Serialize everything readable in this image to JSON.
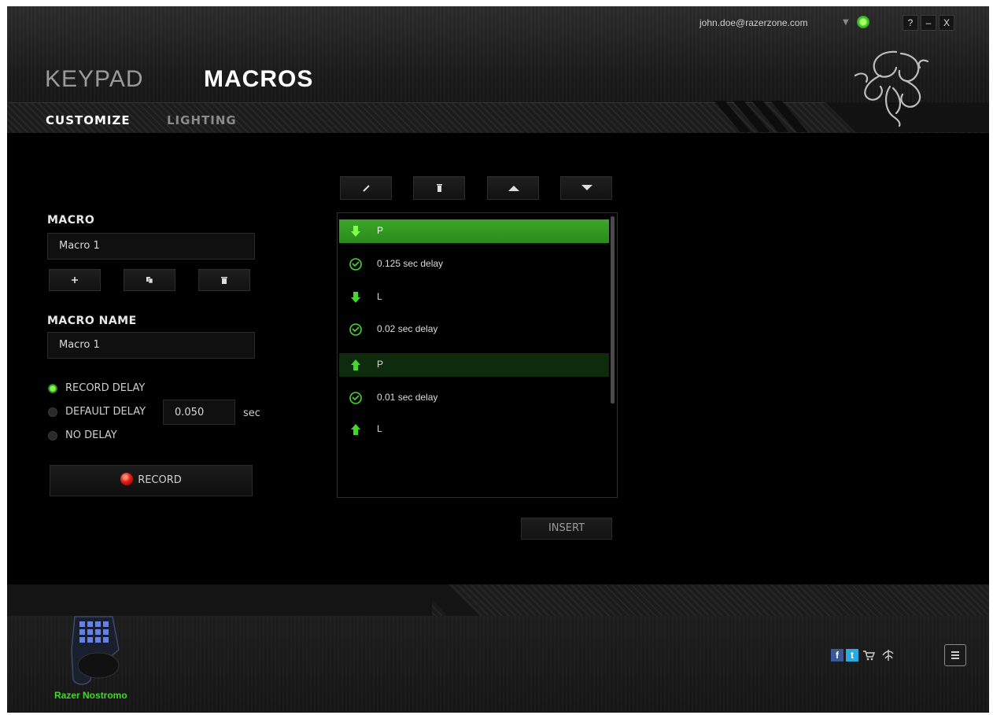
{
  "window": {
    "user_email": "john.doe@razerzone.com",
    "help_label": "?",
    "minimize_label": "–",
    "close_label": "X"
  },
  "nav": {
    "main_tabs": [
      {
        "label": "KEYPAD",
        "active": false
      },
      {
        "label": "MACROS",
        "active": true
      }
    ],
    "sub_tabs": [
      {
        "label": "CUSTOMIZE",
        "active": true
      },
      {
        "label": "LIGHTING",
        "active": false
      }
    ]
  },
  "macro_panel": {
    "macro_label": "MACRO",
    "macro_selected": "Macro 1",
    "macro_name_label": "MACRO NAME",
    "macro_name_value": "Macro 1",
    "delay_options": [
      {
        "label": "RECORD DELAY",
        "selected": true
      },
      {
        "label": "DEFAULT DELAY",
        "selected": false
      },
      {
        "label": "NO DELAY",
        "selected": false
      }
    ],
    "default_delay_value": "0.050",
    "delay_unit": "sec",
    "record_label": "RECORD"
  },
  "macro_list": {
    "items": [
      {
        "type": "key-down",
        "text": "P",
        "icon": "arrow-down-icon",
        "state": "selected"
      },
      {
        "type": "delay",
        "text": "0.125 sec delay",
        "icon": "clock-icon",
        "state": "normal"
      },
      {
        "type": "key-down",
        "text": "L",
        "icon": "arrow-down-icon",
        "state": "normal"
      },
      {
        "type": "delay",
        "text": "0.02 sec delay",
        "icon": "clock-icon",
        "state": "normal"
      },
      {
        "type": "key-up",
        "text": "P",
        "icon": "arrow-up-icon",
        "state": "hover"
      },
      {
        "type": "delay",
        "text": "0.01 sec delay",
        "icon": "clock-icon",
        "state": "normal"
      },
      {
        "type": "key-up",
        "text": "L",
        "icon": "arrow-up-icon",
        "state": "normal"
      }
    ],
    "insert_label": "INSERT"
  },
  "footer": {
    "device_name": "Razer Nostromo"
  },
  "colors": {
    "accent_green": "#44d62c",
    "selected_row": "#3aa827",
    "record_red": "#e01a10"
  }
}
